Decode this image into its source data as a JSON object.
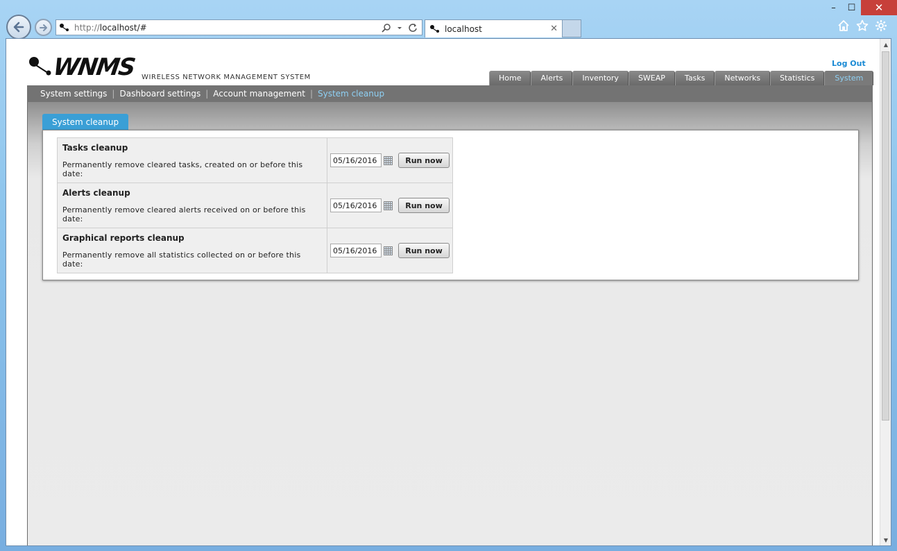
{
  "browser": {
    "url_protocol": "http://",
    "url_host": "localhost/#",
    "tab_title": "localhost",
    "tab_close": "✕",
    "icons": [
      "back-arrow-icon",
      "forward-arrow-icon",
      "search-icon",
      "refresh-icon",
      "home-icon",
      "favorites-star-icon",
      "settings-gear-icon"
    ]
  },
  "window": {
    "minimize": "–",
    "maximize": "☐",
    "close": "✕"
  },
  "app": {
    "logo_text": "WNMS",
    "tagline": "WIRELESS NETWORK MANAGEMENT SYSTEM",
    "logout": "Log Out",
    "main_tabs": [
      {
        "label": "Home"
      },
      {
        "label": "Alerts"
      },
      {
        "label": "Inventory"
      },
      {
        "label": "SWEAP"
      },
      {
        "label": "Tasks"
      },
      {
        "label": "Networks"
      },
      {
        "label": "Statistics"
      },
      {
        "label": "System"
      }
    ],
    "active_main_tab": "System",
    "sub_nav": [
      {
        "label": "System settings"
      },
      {
        "label": "Dashboard settings"
      },
      {
        "label": "Account management"
      },
      {
        "label": "System cleanup"
      }
    ],
    "active_sub_nav": "System cleanup",
    "section_tab": "System cleanup",
    "cleanup_rows": [
      {
        "title": "Tasks cleanup",
        "text": "Permanently remove cleared tasks, created on or before this date:",
        "date": "05/16/2016",
        "button": "Run now"
      },
      {
        "title": "Alerts cleanup",
        "text": "Permanently remove cleared alerts received on or before this date:",
        "date": "05/16/2016",
        "button": "Run now"
      },
      {
        "title": "Graphical reports cleanup",
        "text": "Permanently remove all statistics collected on or before this date:",
        "date": "05/16/2016",
        "button": "Run now"
      }
    ]
  },
  "colors": {
    "accent_blue": "#3a9fd6",
    "active_link": "#8ed0f4",
    "logout_blue": "#1a8ad4",
    "tab_gray": "#737373",
    "window_close": "#c7403a"
  }
}
